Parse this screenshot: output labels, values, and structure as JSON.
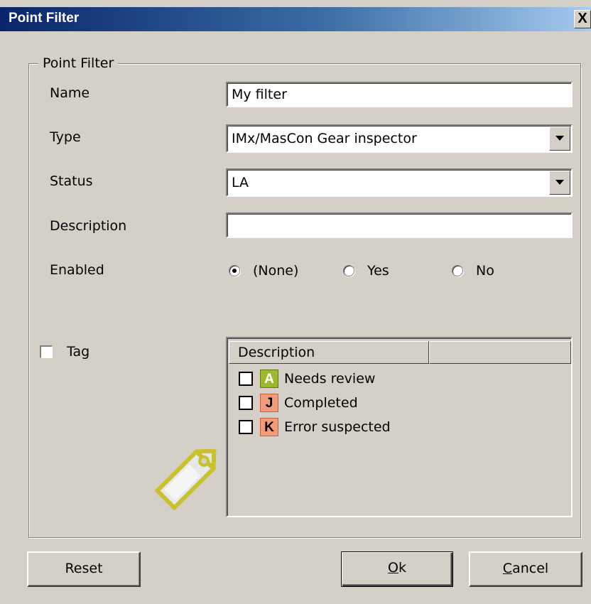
{
  "window": {
    "title": "Point Filter",
    "close_label": "X"
  },
  "group": {
    "legend": "Point Filter"
  },
  "fields": {
    "name": {
      "label": "Name",
      "value": "My filter"
    },
    "type": {
      "label": "Type",
      "value": "IMx/MasCon Gear inspector"
    },
    "status": {
      "label": "Status",
      "value": "LA"
    },
    "description": {
      "label": "Description",
      "value": ""
    },
    "enabled": {
      "label": "Enabled",
      "options": [
        "(None)",
        "Yes",
        "No"
      ],
      "selected": "(None)"
    }
  },
  "tag": {
    "label": "Tag",
    "checked": false,
    "list": {
      "columns": [
        "Description",
        ""
      ],
      "rows": [
        {
          "badge": "A",
          "text": "Needs review",
          "checked": false
        },
        {
          "badge": "J",
          "text": "Completed",
          "checked": false
        },
        {
          "badge": "K",
          "text": "Error suspected",
          "checked": false
        }
      ]
    }
  },
  "buttons": {
    "reset": "Reset",
    "ok_underline": "O",
    "ok_rest": "k",
    "cancel_underline": "C",
    "cancel_rest": "ancel"
  },
  "colors": {
    "title_start": "#0a246a",
    "title_end": "#a6caf0",
    "badge_a": "#9cb82c",
    "badge_j_k": "#f29b7b",
    "tag_icon": "#d7d740"
  },
  "icons": {
    "close": "close-icon",
    "dropdown": "chevron-down-icon",
    "tag": "tag-icon"
  }
}
